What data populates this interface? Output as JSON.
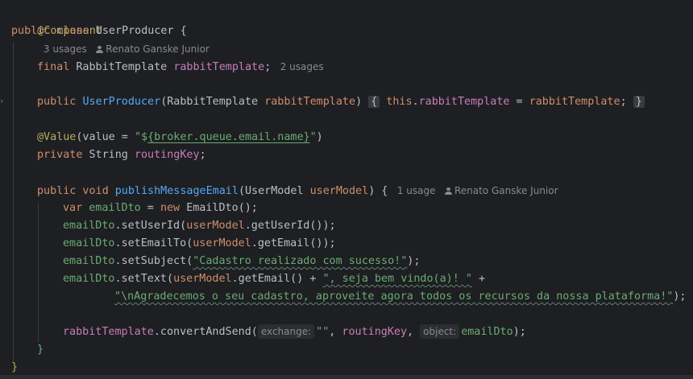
{
  "code": {
    "l1": {
      "annotation": "@Component",
      "usages": "3 usages",
      "author": "Renato Ganske Junior"
    },
    "l2": {
      "kw": "public class ",
      "name": "UserProducer",
      "brace": " {"
    },
    "l4": {
      "kw": "final ",
      "type": "RabbitTemplate ",
      "field": "rabbitTemplate",
      "semi": ";",
      "usages": "2 usages"
    },
    "l6": {
      "kw": "public ",
      "name": "UserProducer",
      "open": "(",
      "type": "RabbitTemplate ",
      "param": "rabbitTemplate",
      "close": ")",
      "fold_open": "{",
      "this": " this",
      "dot": ".",
      "field": "rabbitTemplate",
      "eq": " = ",
      "value": "rabbitTemplate",
      "semi": ";",
      "fold_close": "}"
    },
    "l8": {
      "annotation": "@Value",
      "open": "(value = ",
      "str_open": "\"$",
      "str_expr": "{broker.queue.email.name}",
      "str_close": "\"",
      "close": ")"
    },
    "l9": {
      "kw": "private ",
      "type": "String ",
      "field": "routingKey",
      "semi": ";"
    },
    "l11": {
      "kw": "public void ",
      "name": "publishMessageEmail",
      "open": "(",
      "type": "UserModel ",
      "param": "userModel",
      "close": ") {",
      "usages": "1 usage",
      "author": "Renato Ganske Junior"
    },
    "l12": {
      "kw": "var ",
      "var": "emailDto",
      "eq": " = ",
      "kw2": "new ",
      "type": "EmailDto",
      "end": "();"
    },
    "l13": {
      "var": "emailDto",
      "call": ".setUserId(",
      "param": "userModel",
      "call2": ".getUserId());"
    },
    "l14": {
      "var": "emailDto",
      "call": ".setEmailTo(",
      "param": "userModel",
      "call2": ".getEmail());"
    },
    "l15": {
      "var": "emailDto",
      "call": ".setSubject(",
      "str": "\"Cadastro realizado com sucesso!\"",
      "end": ");"
    },
    "l16": {
      "var": "emailDto",
      "call": ".setText(",
      "param": "userModel",
      "call2": ".getEmail() + ",
      "str": "\", seja bem vindo(a)! \"",
      "end": " +"
    },
    "l17": {
      "str": "\"\\nAgradecemos o seu cadastro, aproveite agora todos os recursos da nossa plataforma!\"",
      "end": ");"
    },
    "l19": {
      "field": "rabbitTemplate",
      "call": ".convertAndSend(",
      "hint1": "exchange:",
      "str": "\"\"",
      "sep": ", ",
      "field2": "routingKey",
      "sep2": ", ",
      "hint2": "object:",
      "var": "emailDto",
      "end": ");"
    },
    "l20": {
      "brace": "}"
    },
    "l21": {
      "brace": "}"
    }
  },
  "colors": {
    "background": "#1e1f22",
    "keyword": "#cf8e6d",
    "annotation": "#b3ae60",
    "field": "#c77dbb",
    "method": "#56a8f5",
    "string": "#6aab73",
    "text": "#bcbec4",
    "inlay": "#868a91"
  }
}
